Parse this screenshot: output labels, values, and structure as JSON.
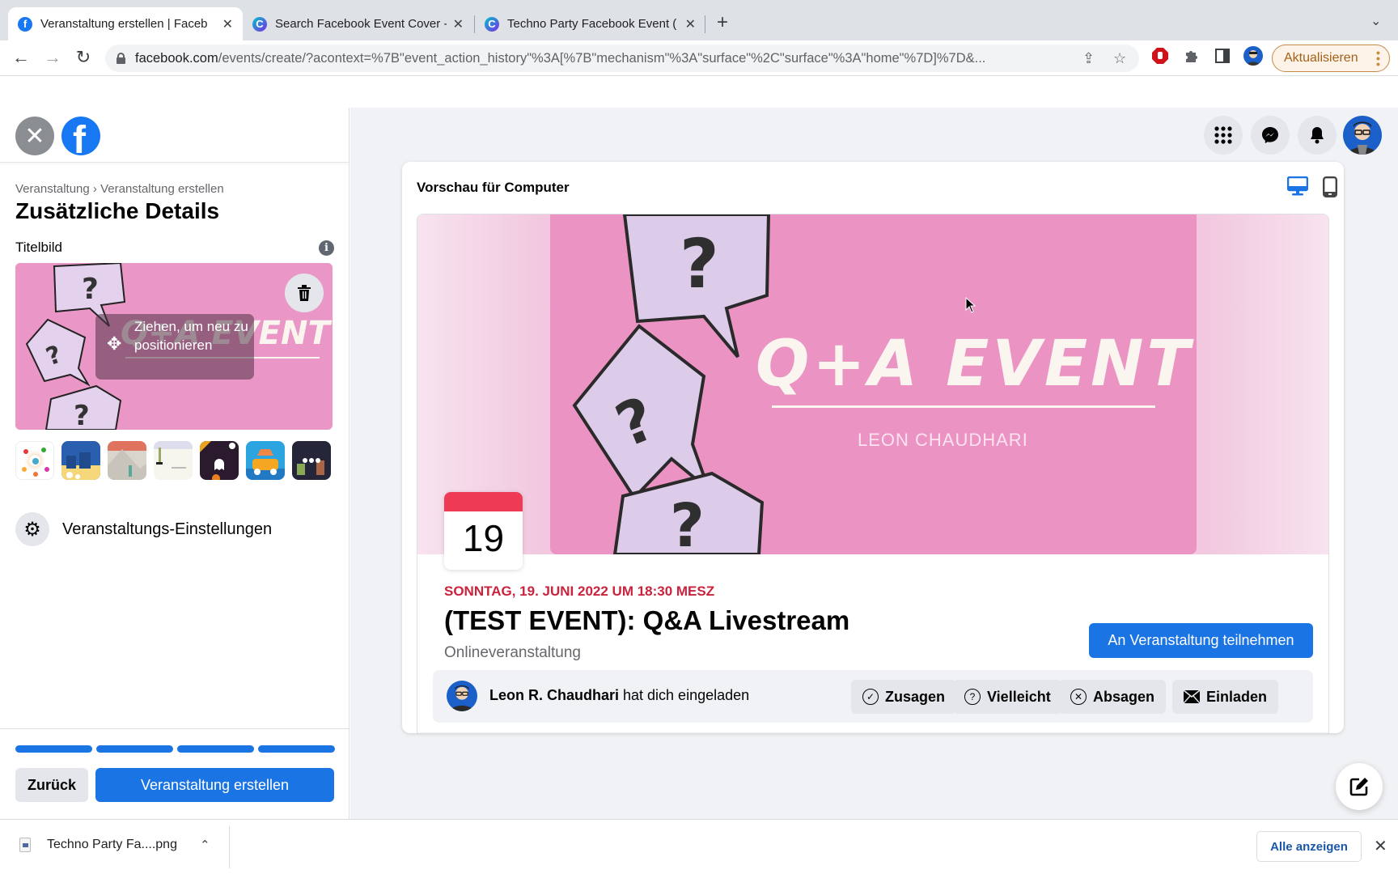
{
  "browser": {
    "tabs": [
      {
        "title": "Veranstaltung erstellen | Faceb",
        "favicon": "facebook-icon",
        "active": true
      },
      {
        "title": "Search Facebook Event Cover -",
        "favicon": "canva-icon",
        "active": false
      },
      {
        "title": "Techno Party Facebook Event (",
        "favicon": "canva-icon",
        "active": false
      }
    ],
    "url_domain": "facebook.com",
    "url_path": "/events/create/?acontext=%7B\"event_action_history\"%3A[%7B\"mechanism\"%3A\"surface\"%2C\"surface\"%3A\"home\"%7D]%7D&...",
    "update_button": "Aktualisieren",
    "colors": {
      "tabstrip": "#dee1e6",
      "update_accent": "#a55f16"
    }
  },
  "left_panel": {
    "breadcrumb": [
      "Veranstaltung",
      "Veranstaltung erstellen"
    ],
    "breadcrumb_sep": "›",
    "title": "Zusätzliche Details",
    "cover_label": "Titelbild",
    "drag_hint": "Ziehen, um neu zu positionieren",
    "themes": [
      "confetti-theme",
      "winter-town-theme",
      "mountain-theme",
      "snow-theme",
      "halloween-theme",
      "road-trip-theme",
      "plants-theme"
    ],
    "settings_label": "Veranstaltungs-Einstellungen",
    "progress": {
      "steps_total": 4,
      "steps_completed": 4
    },
    "back_button": "Zurück",
    "create_button": "Veranstaltung erstellen"
  },
  "preview": {
    "heading": "Vorschau für Computer",
    "active_view": "desktop",
    "banner": {
      "title": "Q+A EVENT",
      "subtitle": "LEON CHAUDHARI"
    },
    "calendar_day": "19",
    "date_line": "SONNTAG, 19. JUNI 2022 UM 18:30 MESZ",
    "event_title": "(TEST EVENT): Q&A Livestream",
    "event_type": "Onlineveranstaltung",
    "join_button": "An Veranstaltung teilnehmen",
    "invite": {
      "host": "Leon R. Chaudhari",
      "text": " hat dich eingeladen"
    },
    "rsvp": [
      {
        "label": "Zusagen",
        "icon": "check-circle-icon"
      },
      {
        "label": "Vielleicht",
        "icon": "question-circle-icon"
      },
      {
        "label": "Absagen",
        "icon": "x-circle-icon"
      },
      {
        "label": "Einladen",
        "icon": "envelope-icon"
      }
    ],
    "colors": {
      "primary": "#1b74e4",
      "date": "#c9233d",
      "calendar_top": "#ef3a55",
      "banner": "#eb94c4"
    }
  },
  "downloads": {
    "file_name": "Techno Party Fa....png",
    "show_all": "Alle anzeigen"
  }
}
